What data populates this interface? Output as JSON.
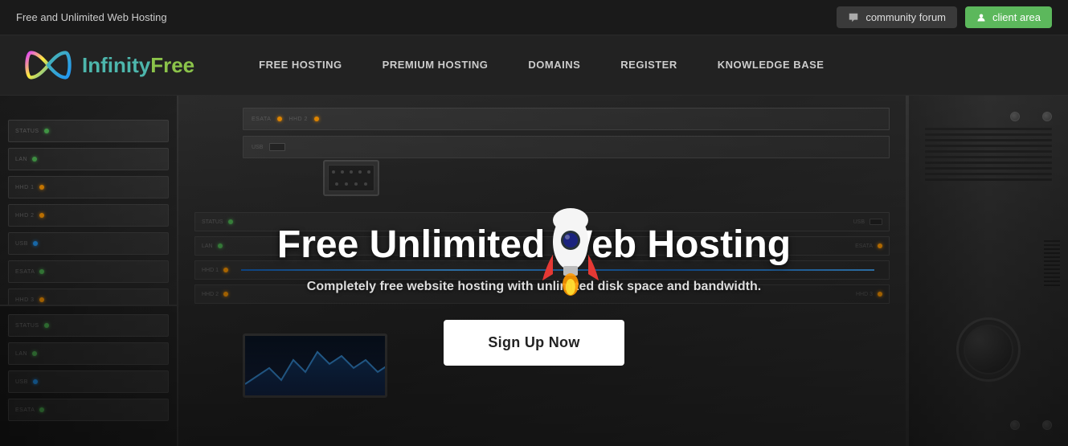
{
  "topbar": {
    "title": "Free and Unlimited Web Hosting",
    "community_label": "community forum",
    "client_label": "client area"
  },
  "nav": {
    "logo_infinity": "Infinity",
    "logo_free": "Free",
    "links": [
      {
        "label": "FREE HOSTING",
        "id": "free-hosting"
      },
      {
        "label": "PREMIUM HOSTING",
        "id": "premium-hosting"
      },
      {
        "label": "DOMAINS",
        "id": "domains"
      },
      {
        "label": "REGISTER",
        "id": "register"
      },
      {
        "label": "KNOWLEDGE BASE",
        "id": "knowledge-base"
      }
    ]
  },
  "hero": {
    "title": "Free Unlimited Web Hosting",
    "subtitle": "Completely free website hosting with unlimited disk space and bandwidth.",
    "cta_label": "Sign Up Now"
  }
}
